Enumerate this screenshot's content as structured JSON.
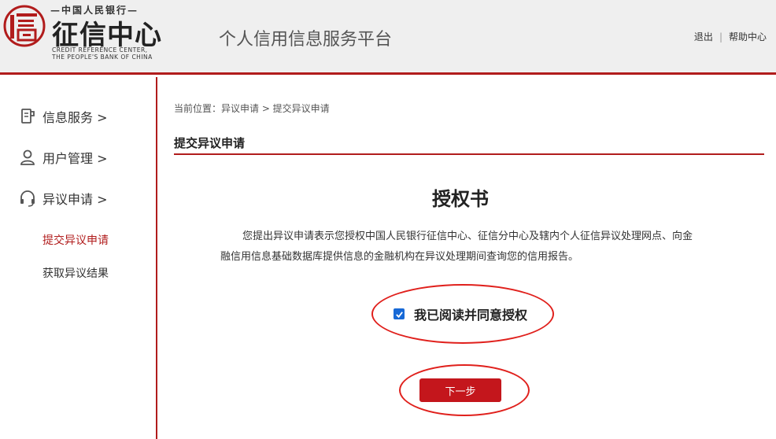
{
  "header": {
    "logo_top": "—中国人民银行—",
    "logo_main": "征信中心",
    "logo_en_line1": "CREDIT REFERENCE CENTER,",
    "logo_en_line2": "THE PEOPLE'S BANK OF CHINA",
    "platform_title": "个人信用信息服务平台",
    "logout_label": "退出",
    "separator": "|",
    "help_label": "帮助中心"
  },
  "sidebar": {
    "items": [
      {
        "label": "信息服务 >",
        "icon": "document-icon"
      },
      {
        "label": "用户管理 >",
        "icon": "user-icon"
      },
      {
        "label": "异议申请 >",
        "icon": "headset-icon"
      }
    ],
    "sub_items": [
      {
        "label": "提交异议申请",
        "active": true
      },
      {
        "label": "获取异议结果",
        "active": false
      }
    ]
  },
  "main": {
    "breadcrumb": "当前位置：异议申请 > 提交异议申请",
    "section_title": "提交异议申请",
    "doc_title": "授权书",
    "doc_text": "您提出异议申请表示您授权中国人民银行征信中心、征信分中心及辖内个人征信异议处理网点、向金融信用信息基础数据库提供信息的金融机构在异议处理期间查询您的信用报告。",
    "agree_label": "我已阅读并同意授权",
    "agree_checked": true,
    "next_button": "下一步"
  },
  "colors": {
    "brand_red": "#b11c1c",
    "button_red": "#c4161c",
    "annotation_red": "#e0201c",
    "checkbox_blue": "#1769d6"
  }
}
